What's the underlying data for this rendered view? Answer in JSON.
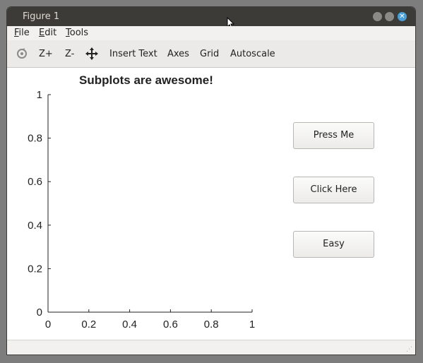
{
  "window": {
    "title": "Figure 1"
  },
  "menu": [
    {
      "label": "File",
      "underline": "F",
      "rest": "ile"
    },
    {
      "label": "Edit",
      "underline": "E",
      "rest": "dit"
    },
    {
      "label": "Tools",
      "underline": "T",
      "rest": "ools"
    }
  ],
  "toolbar": {
    "zoom_in": "Z+",
    "zoom_out": "Z-",
    "insert_text": "Insert Text",
    "axes": "Axes",
    "grid": "Grid",
    "autoscale": "Autoscale"
  },
  "buttons": {
    "press_me": "Press Me",
    "click_here": "Click Here",
    "easy": "Easy"
  },
  "colors": {
    "close_button": "#4a9fd8",
    "titlebar": "#3c3b37"
  },
  "chart_data": {
    "type": "line",
    "title": "Subplots are awesome!",
    "xlabel": "",
    "ylabel": "",
    "xlim": [
      0,
      1
    ],
    "ylim": [
      0,
      1
    ],
    "xticks": [
      "0",
      "0.2",
      "0.4",
      "0.6",
      "0.8",
      "1"
    ],
    "yticks": [
      "0",
      "0.2",
      "0.4",
      "0.6",
      "0.8",
      "1"
    ],
    "series": [],
    "grid": false
  }
}
